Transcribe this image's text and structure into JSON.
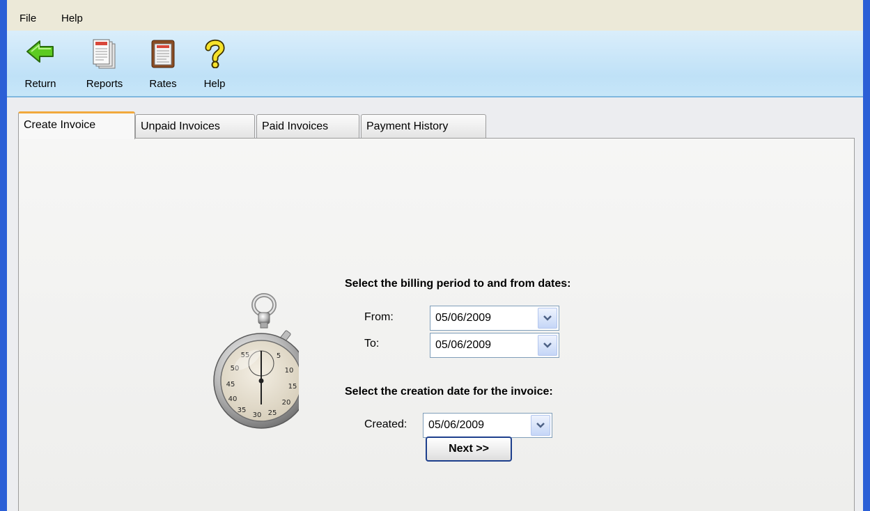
{
  "menu": {
    "file": "File",
    "help": "Help"
  },
  "toolbar": {
    "return_label": "Return",
    "reports_label": "Reports",
    "rates_label": "Rates",
    "help_label": "Help"
  },
  "tabs": [
    {
      "label": "Create Invoice",
      "active": true
    },
    {
      "label": "Unpaid Invoices",
      "active": false
    },
    {
      "label": "Paid Invoices",
      "active": false
    },
    {
      "label": "Payment History",
      "active": false
    }
  ],
  "form": {
    "billing_heading": "Select the billing period to and from dates:",
    "from_label": "From:",
    "from_value": "05/06/2009",
    "to_label": "To:",
    "to_value": "05/06/2009",
    "creation_heading": "Select the creation date for the invoice:",
    "created_label": "Created:",
    "created_value": "05/06/2009",
    "next_label": "Next >>"
  },
  "stopwatch_dial": [
    "5",
    "10",
    "15",
    "20",
    "25",
    "30",
    "35",
    "40",
    "45",
    "50",
    "55"
  ],
  "colors": {
    "active_tab_accent": "#f1a93d",
    "toolbar_bg": "#c7e6f8",
    "window_frame": "#2b5fd6"
  }
}
